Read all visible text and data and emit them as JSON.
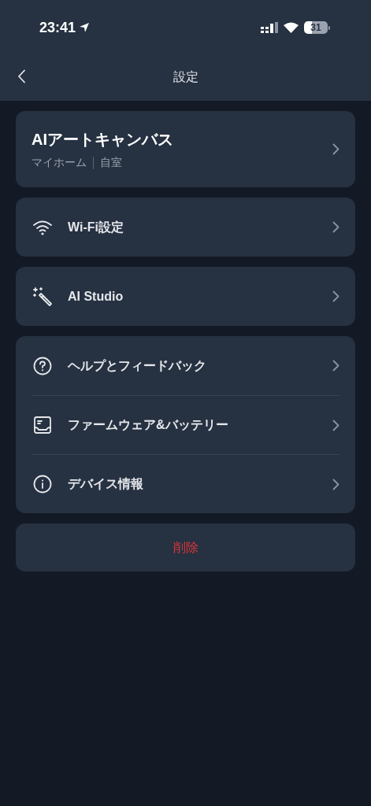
{
  "status_bar": {
    "time": "23:41",
    "battery": "31"
  },
  "header": {
    "title": "設定"
  },
  "device": {
    "name": "AIアートキャンバス",
    "home": "マイホーム",
    "room": "自室"
  },
  "groups": [
    {
      "items": [
        {
          "kind": "wifi",
          "label": "Wi-Fi設定"
        }
      ]
    },
    {
      "items": [
        {
          "kind": "wand",
          "label": "AI Studio"
        }
      ]
    },
    {
      "items": [
        {
          "kind": "help",
          "label": "ヘルプとフィードバック"
        },
        {
          "kind": "firmware",
          "label": "ファームウェア&バッテリー"
        },
        {
          "kind": "info",
          "label": "デバイス情報"
        }
      ]
    }
  ],
  "delete_button": "削除"
}
